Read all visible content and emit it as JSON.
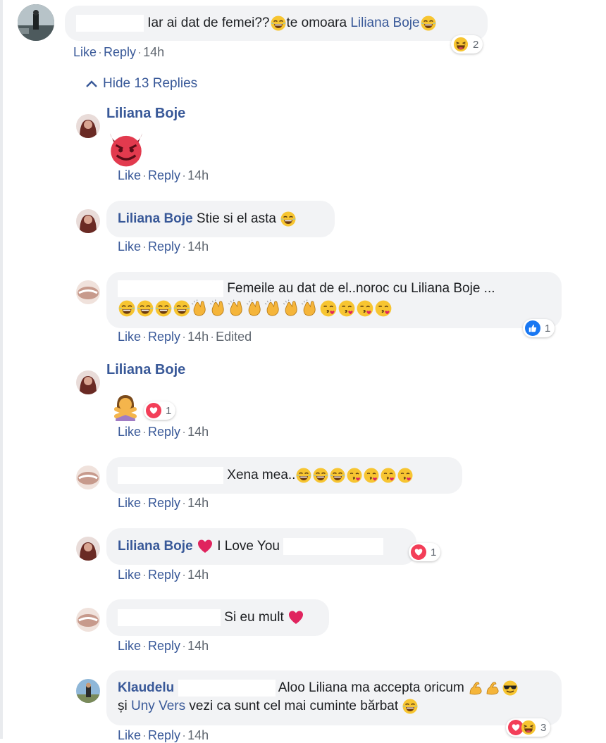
{
  "main_comment": {
    "text_1": "Iar ai dat de femei??",
    "text_2": "te omoara",
    "mention": "Liliana Boje",
    "like": "Like",
    "reply": "Reply",
    "time": "14h",
    "reaction_count": "2"
  },
  "toggle_label": "Hide 13 Replies",
  "replies": [
    {
      "name": "Liliana Boje",
      "like": "Like",
      "reply": "Reply",
      "time": "14h"
    },
    {
      "name": "Liliana Boje",
      "text": "Stie si el asta",
      "like": "Like",
      "reply": "Reply",
      "time": "14h"
    },
    {
      "text": "Femeile au dat de el..noroc cu Liliana Boje ...",
      "like": "Like",
      "reply": "Reply",
      "time": "14h",
      "edited": "Edited",
      "reaction_count": "1"
    },
    {
      "name": "Liliana Boje",
      "like": "Like",
      "reply": "Reply",
      "time": "14h",
      "reaction_count": "1"
    },
    {
      "text": "Xena mea..",
      "like": "Like",
      "reply": "Reply",
      "time": "14h"
    },
    {
      "name": "Liliana Boje",
      "text": "I Love You",
      "like": "Like",
      "reply": "Reply",
      "time": "14h",
      "reaction_count": "1"
    },
    {
      "text": "Si eu mult",
      "like": "Like",
      "reply": "Reply",
      "time": "14h"
    },
    {
      "name": "Klaudelu",
      "text_1": "Aloo Liliana ma accepta oricum",
      "text_2a": "și",
      "mention": "Uny Vers",
      "text_2b": "vezi ca sunt cel mai cuminte bărbat",
      "like": "Like",
      "reply": "Reply",
      "time": "14h",
      "reaction_count": "3"
    }
  ],
  "separator": "·",
  "colors": {
    "link": "#385898",
    "bubble": "#f2f3f5",
    "meta": "#606770",
    "like": "#1877f2",
    "love": "#f33e58"
  }
}
